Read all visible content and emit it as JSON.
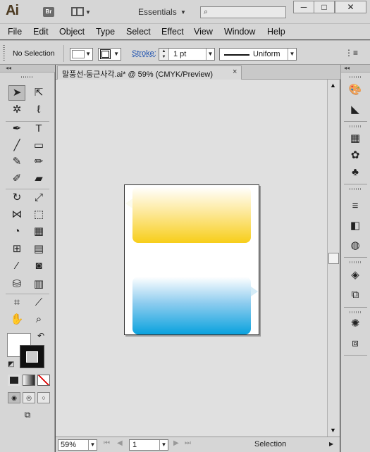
{
  "app": {
    "logo": "Ai",
    "bridge_label": "Br",
    "workspace": "Essentials",
    "search_placeholder": ""
  },
  "window_controls": {
    "minimize": "─",
    "maximize": "□",
    "close": "✕"
  },
  "menu": [
    "File",
    "Edit",
    "Object",
    "Type",
    "Select",
    "Effect",
    "View",
    "Window",
    "Help"
  ],
  "control_bar": {
    "selection": "No Selection",
    "stroke_label": "Stroke:",
    "stroke_weight": "1 pt",
    "profile": "Uniform"
  },
  "document": {
    "tab_title": "말풍선-둥근사각.ai* @ 59% (CMYK/Preview)",
    "close": "×"
  },
  "status": {
    "zoom": "59%",
    "page": "1",
    "tool": "Selection"
  },
  "colors": {
    "bubble_yellow": "#f7ce1a",
    "bubble_blue": "#0aa2de",
    "ui_gray": "#d6d6d6"
  },
  "icons": {
    "tools": [
      "selection-icon",
      "direct-selection-icon",
      "magic-wand-icon",
      "lasso-icon",
      "pen-icon",
      "type-icon",
      "line-icon",
      "rectangle-icon",
      "paintbrush-icon",
      "pencil-icon",
      "blob-brush-icon",
      "eraser-icon",
      "rotate-icon",
      "scale-icon",
      "width-icon",
      "free-transform-icon",
      "shape-builder-icon",
      "perspective-grid-icon",
      "mesh-icon",
      "gradient-icon",
      "eyedropper-icon",
      "blend-icon",
      "symbol-sprayer-icon",
      "column-graph-icon",
      "artboard-icon",
      "slice-icon",
      "hand-icon",
      "zoom-icon"
    ],
    "dock": [
      "color-icon",
      "color-guide-icon",
      "swatches-icon",
      "brushes-icon",
      "symbols-icon",
      "stroke-icon",
      "gradient-icon",
      "transparency-icon",
      "appearance-icon",
      "layers-icon",
      "artboards-icon",
      "align-icon",
      "transform-icon"
    ]
  }
}
